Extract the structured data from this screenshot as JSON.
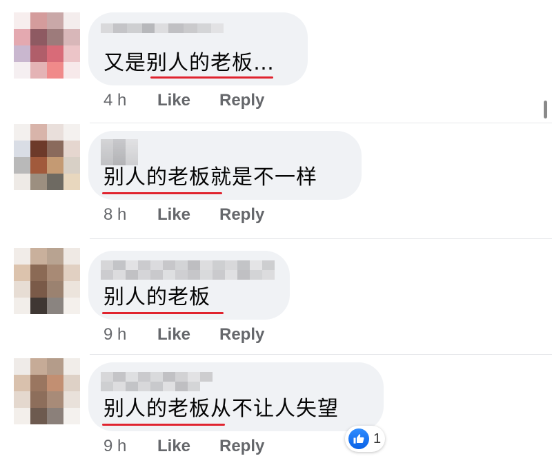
{
  "colors": {
    "underline": "#e0232e",
    "bubble": "#f0f2f5",
    "meta_text": "#65676b",
    "like_blue": "#1877f2"
  },
  "comments": [
    {
      "text": "又是别人的老板…",
      "time": "4 h",
      "like": "Like",
      "reply": "Reply"
    },
    {
      "text": "别人的老板就是不一样",
      "time": "8 h",
      "like": "Like",
      "reply": "Reply"
    },
    {
      "text": "别人的老板",
      "time": "9 h",
      "like": "Like",
      "reply": "Reply"
    },
    {
      "text": "别人的老板从不让人失望",
      "time": "9 h",
      "like": "Like",
      "reply": "Reply",
      "reaction": {
        "icon": "thumbs-up-icon",
        "count": "1"
      }
    }
  ]
}
